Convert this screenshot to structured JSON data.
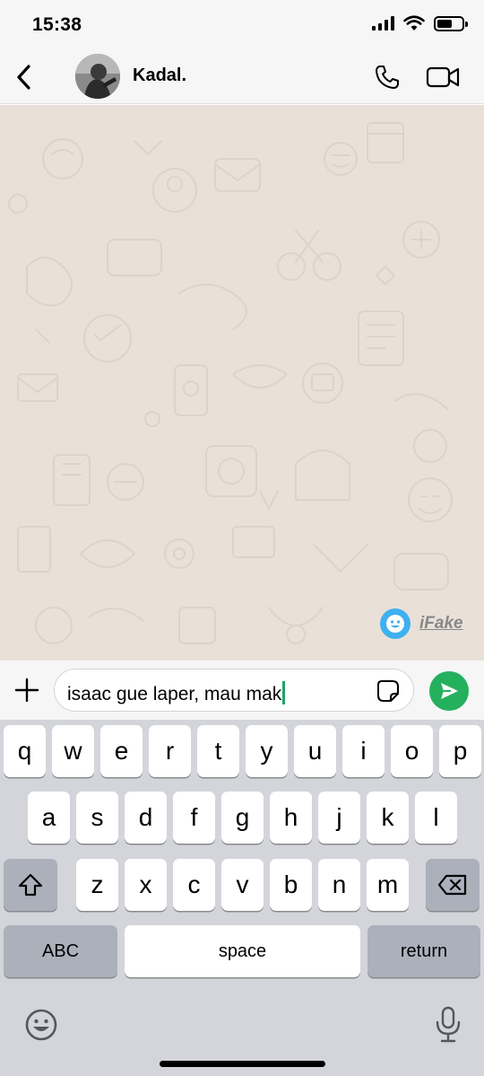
{
  "status_bar": {
    "time": "15:38",
    "battery_level": 0.6,
    "signal_bars": 4
  },
  "header": {
    "back_icon": "chevron-left-icon",
    "contact_name": "Kadal.",
    "call_icon": "phone-icon",
    "video_icon": "video-camera-icon"
  },
  "chat": {
    "watermark_text": "iFake",
    "watermark_color": "#3fb0f0",
    "background_color": "#e9e1d8"
  },
  "composer": {
    "plus_icon": "plus-icon",
    "text_value": "isaac gue laper, mau mak",
    "sticker_icon": "sticker-icon",
    "send_icon": "send-icon",
    "send_color": "#25b05e",
    "caret_color": "#1ea463"
  },
  "keyboard": {
    "row1": [
      "q",
      "w",
      "e",
      "r",
      "t",
      "y",
      "u",
      "i",
      "o",
      "p"
    ],
    "row2": [
      "a",
      "s",
      "d",
      "f",
      "g",
      "h",
      "j",
      "k",
      "l"
    ],
    "row3": [
      "z",
      "x",
      "c",
      "v",
      "b",
      "n",
      "m"
    ],
    "shift_icon": "shift-icon",
    "backspace_icon": "backspace-icon",
    "abc_label": "ABC",
    "space_label": "space",
    "return_label": "return",
    "emoji_icon": "emoji-icon",
    "mic_icon": "microphone-icon"
  }
}
